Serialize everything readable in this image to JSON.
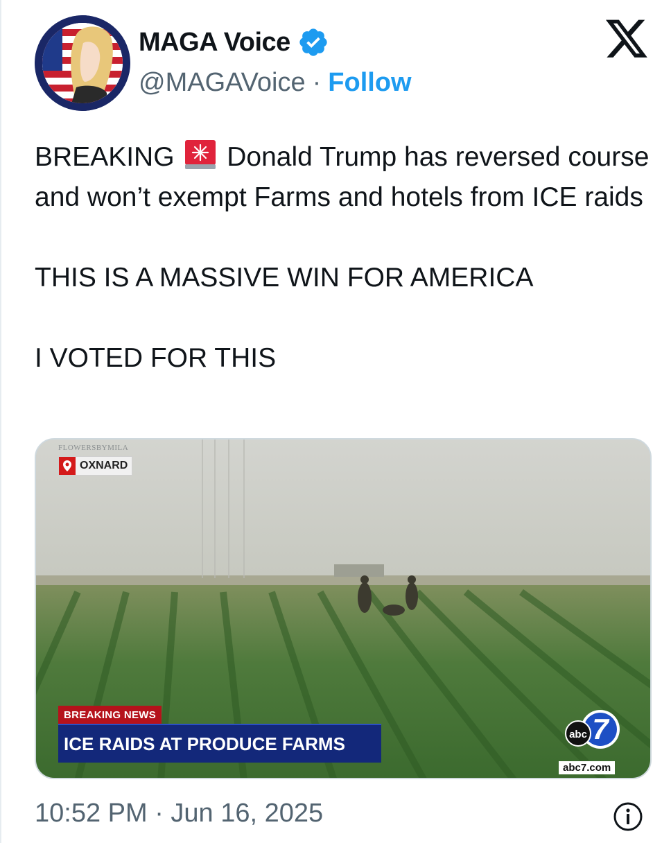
{
  "author": {
    "display_name": "MAGA Voice",
    "handle": "@MAGAVoice",
    "separator": "·",
    "follow_label": "Follow",
    "verified": true,
    "verified_color": "#1d9bf0"
  },
  "platform": {
    "logo_icon": "x-logo-icon"
  },
  "tweet": {
    "line1_before": "BREAKING",
    "line1_emoji": "siren-icon",
    "line1_after": "Donald Trump has reversed course and won’t exempt Farms and hotels from ICE raids",
    "paragraph2": "THIS IS A MASSIVE WIN FOR AMERICA",
    "paragraph3": "I VOTED FOR THIS"
  },
  "media": {
    "credit": "FLOWERSBYMILA",
    "location": "OXNARD",
    "breaking_label": "BREAKING NEWS",
    "headline": "ICE RAIDS AT PRODUCE FARMS",
    "network_logo_text": "abc",
    "network_channel": "7",
    "network_url": "abc7.com"
  },
  "footer": {
    "timestamp": "10:52 PM · Jun 16, 2025",
    "info_icon": "info-icon"
  },
  "colors": {
    "link": "#1d9bf0",
    "secondary_text": "#536471",
    "breaking_red": "#b5121b",
    "headline_blue": "#13287a"
  }
}
